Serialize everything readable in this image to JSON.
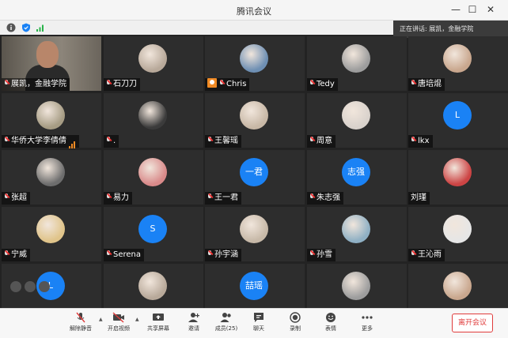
{
  "app": {
    "title": "腾讯会议"
  },
  "speaking_banner": "正在讲话: 展凯，金融学院",
  "participants": [
    {
      "name": "展凯，金融学院",
      "type": "video",
      "muted": true
    },
    {
      "name": "石刀刀",
      "type": "image",
      "muted": true
    },
    {
      "name": "Chris",
      "type": "image",
      "muted": true,
      "host": true
    },
    {
      "name": "Tedy",
      "type": "image",
      "muted": true
    },
    {
      "name": "唐培焜",
      "type": "image",
      "muted": true
    },
    {
      "name": "华侨大学李倩倩",
      "type": "image",
      "muted": true,
      "signal": true
    },
    {
      "name": ".",
      "type": "image",
      "muted": true
    },
    {
      "name": "王馨瑶",
      "type": "image",
      "muted": true
    },
    {
      "name": "周意",
      "type": "image",
      "muted": true
    },
    {
      "name": "lkx",
      "type": "initial",
      "initial": "L",
      "muted": true
    },
    {
      "name": "张超",
      "type": "image",
      "muted": true
    },
    {
      "name": "易力",
      "type": "image",
      "muted": true
    },
    {
      "name": "王一君",
      "type": "initial",
      "initial": "一君",
      "muted": true
    },
    {
      "name": "朱志强",
      "type": "initial",
      "initial": "志强",
      "muted": true
    },
    {
      "name": "刘瑾",
      "type": "image",
      "muted": false
    },
    {
      "name": "宁威",
      "type": "image",
      "muted": true
    },
    {
      "name": "Serena",
      "type": "initial",
      "initial": "S",
      "muted": true
    },
    {
      "name": "孙宇涵",
      "type": "image",
      "muted": true
    },
    {
      "name": "孙雪",
      "type": "image",
      "muted": true
    },
    {
      "name": "王沁雨",
      "type": "image",
      "muted": true
    },
    {
      "name": "",
      "type": "initial",
      "initial": "L",
      "muted": false
    },
    {
      "name": "",
      "type": "image",
      "muted": false
    },
    {
      "name": "",
      "type": "initial",
      "initial": "喆瑶",
      "muted": false
    },
    {
      "name": "",
      "type": "image",
      "muted": false
    },
    {
      "name": "",
      "type": "image",
      "muted": false
    }
  ],
  "toolbar": {
    "unmute": "解除静音",
    "video": "开启视频",
    "share": "共享屏幕",
    "invite": "邀请",
    "members": "成员(25)",
    "chat": "聊天",
    "record": "录制",
    "reactions": "表情",
    "more": "更多",
    "leave": "离开会议"
  },
  "colors": {
    "accent": "#1a82f5",
    "danger": "#e03c3c",
    "host": "#f08a24"
  }
}
